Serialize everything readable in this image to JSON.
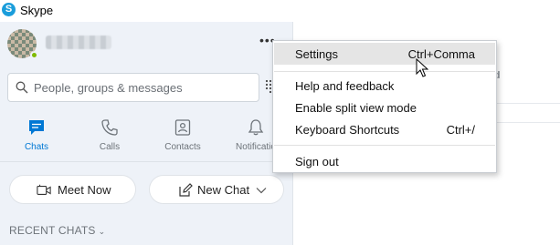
{
  "app": {
    "title": "Skype",
    "logo_letter": "S"
  },
  "profile": {
    "more_label": "•••"
  },
  "search": {
    "placeholder": "People, groups & messages"
  },
  "nav": {
    "tabs": [
      {
        "label": "Chats",
        "icon": "chat-bubble-icon",
        "active": true
      },
      {
        "label": "Calls",
        "icon": "phone-icon",
        "active": false
      },
      {
        "label": "Contacts",
        "icon": "contacts-icon",
        "active": false
      },
      {
        "label": "Notificatio",
        "icon": "bell-icon",
        "active": false
      }
    ]
  },
  "actions": {
    "meet_now": "Meet Now",
    "new_chat": "New Chat"
  },
  "recent": {
    "label": "RECENT CHATS"
  },
  "main": {
    "partial_text": "nd"
  },
  "menu": {
    "items": [
      {
        "label": "Settings",
        "shortcut": "Ctrl+Comma",
        "hovered": true
      },
      {
        "label": "Help and feedback",
        "shortcut": ""
      },
      {
        "label": "Enable split view mode",
        "shortcut": ""
      },
      {
        "label": "Keyboard Shortcuts",
        "shortcut": "Ctrl+/"
      },
      {
        "label": "Sign out",
        "shortcut": ""
      }
    ]
  },
  "colors": {
    "accent": "#0078d4",
    "sidebar_bg": "#eef2f8",
    "presence": "#7fba00",
    "skype_blue": "#1a9ddb"
  }
}
